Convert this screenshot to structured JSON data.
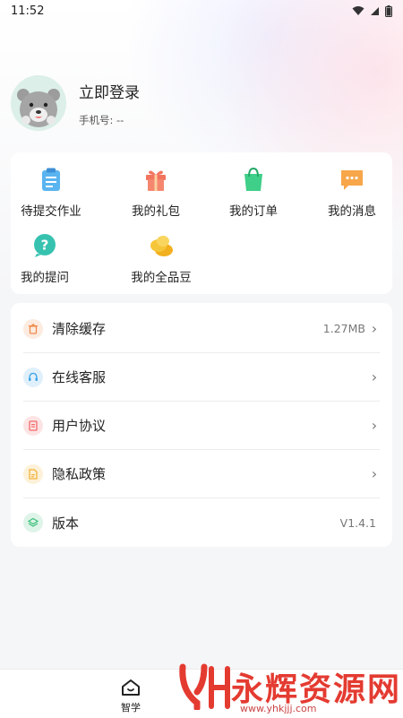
{
  "status_bar": {
    "time": "11:52"
  },
  "profile": {
    "login_text": "立即登录",
    "phone_label": "手机号: --"
  },
  "grid": [
    {
      "label": "待提交作业",
      "icon": "clipboard-icon"
    },
    {
      "label": "我的礼包",
      "icon": "gift-icon"
    },
    {
      "label": "我的订单",
      "icon": "shopping-bag-icon"
    },
    {
      "label": "我的消息",
      "icon": "message-icon"
    },
    {
      "label": "我的提问",
      "icon": "question-icon"
    },
    {
      "label": "我的全品豆",
      "icon": "coins-icon"
    }
  ],
  "menu": [
    {
      "label": "清除缓存",
      "value": "1.27MB",
      "icon": "trash-icon",
      "color": "#f08a4b"
    },
    {
      "label": "在线客服",
      "value": "",
      "icon": "headset-icon",
      "color": "#3aa3e8"
    },
    {
      "label": "用户协议",
      "value": "",
      "icon": "document-icon",
      "color": "#f26a6a"
    },
    {
      "label": "隐私政策",
      "value": "",
      "icon": "file-icon",
      "color": "#f2b23a"
    },
    {
      "label": "版本",
      "value": "V1.4.1",
      "icon": "layers-icon",
      "color": "#3cbf7a"
    }
  ],
  "tabbar": {
    "home_label": "智学"
  },
  "watermark": {
    "text": "永辉资源网",
    "url": "www.yhkjjj.com"
  }
}
